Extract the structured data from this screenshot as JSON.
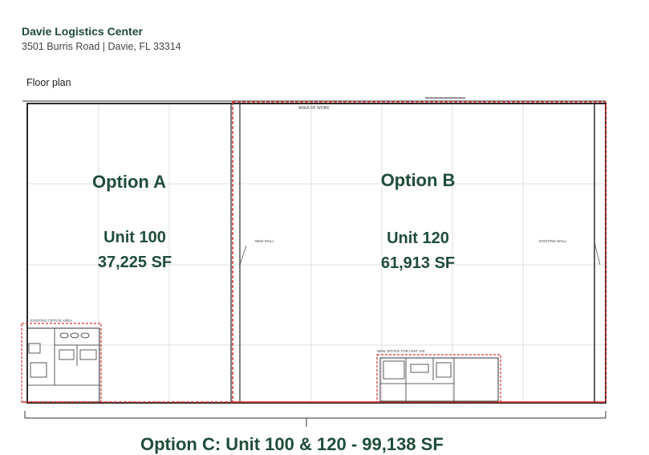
{
  "header": {
    "title": "Davie Logistics Center",
    "address": "3501 Burris Road  |  Davie, FL 33314"
  },
  "floor_plan": {
    "label": "Floor plan",
    "area_of_work_note": "AREA OF WORK",
    "option_a": {
      "option_label": "Option A",
      "unit_label": "Unit 100",
      "area_label": "37,225 SF",
      "office_note": "EXISTING OFFICE AREA"
    },
    "option_b": {
      "option_label": "Option B",
      "unit_label": "Unit 120",
      "area_label": "61,913 SF",
      "new_wall_note": "NEW WALL",
      "existing_wall_note": "EXISTING WALL",
      "office_note": "NEW OFFICE FOR UNIT 120"
    },
    "bottom_caption": "Option C: Unit 100 & 120 - 99,138 SF",
    "colors": {
      "label_green": "#1f4d3a",
      "boundary_red": "#d9302c"
    }
  }
}
